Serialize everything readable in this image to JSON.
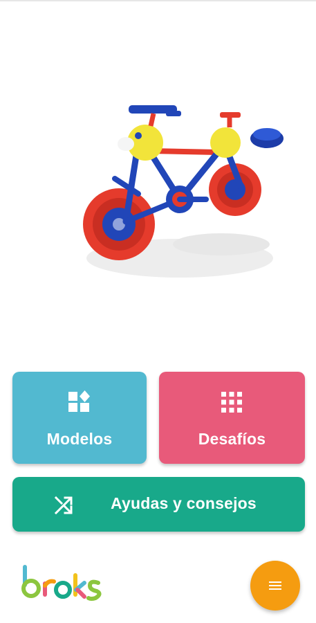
{
  "tiles": {
    "modelos": {
      "label": "Modelos",
      "color": "#52b9d0",
      "icon": "shapes-icon"
    },
    "desafios": {
      "label": "Desafíos",
      "color": "#e85a7a",
      "icon": "grid-icon"
    },
    "ayudas": {
      "label": "Ayudas y consejos",
      "color": "#18a98a",
      "icon": "shuffle-icon"
    }
  },
  "brand": {
    "logo_text": "broks"
  },
  "fab": {
    "icon": "menu-icon",
    "color": "#f59c10"
  }
}
